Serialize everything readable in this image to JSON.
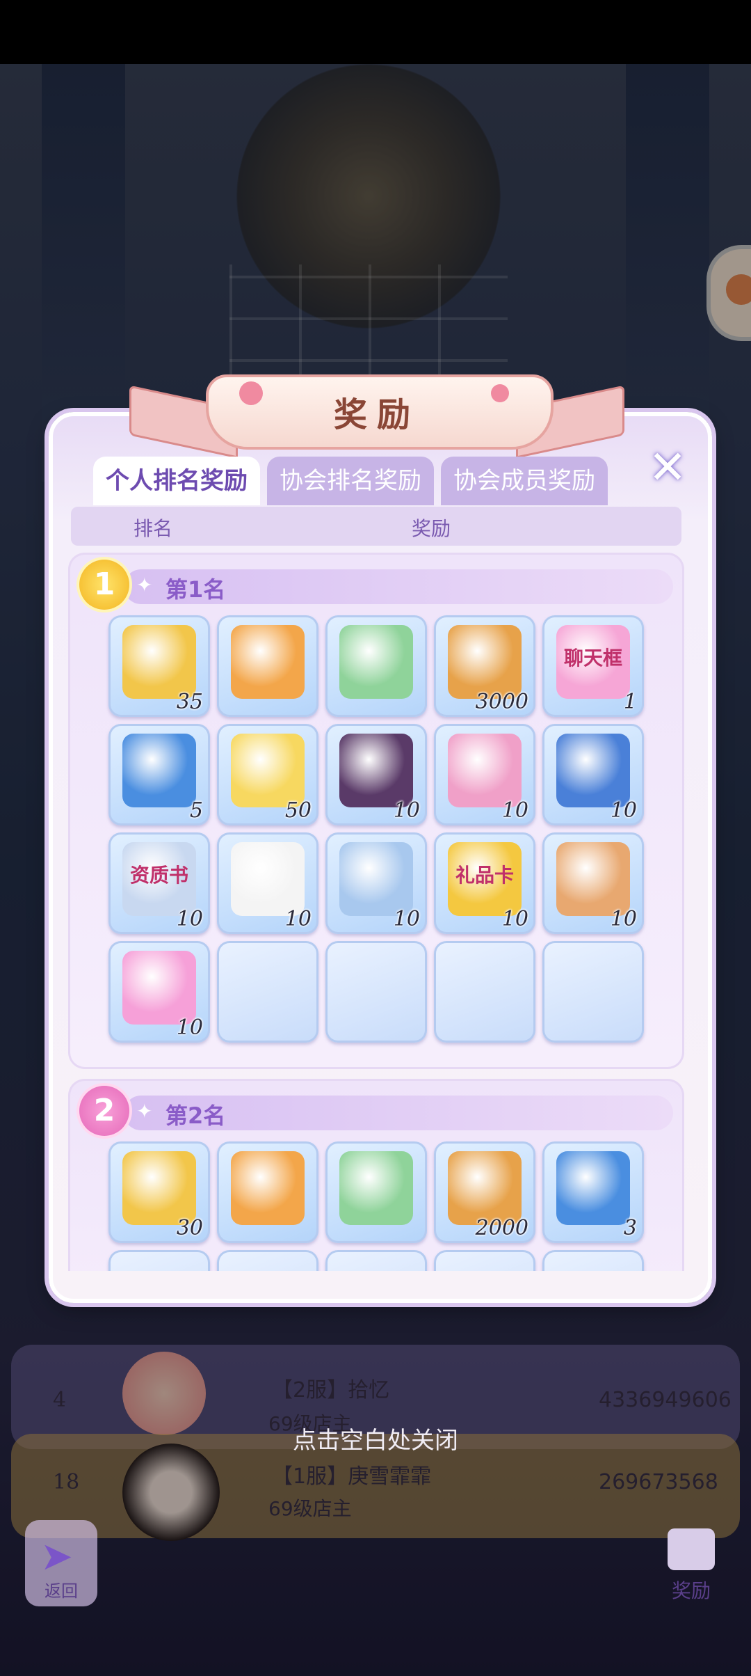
{
  "panel": {
    "title": "奖励",
    "tabs": [
      {
        "label": "个人排名奖励",
        "active": true
      },
      {
        "label": "协会排名奖励",
        "active": false
      },
      {
        "label": "协会成员奖励",
        "active": false
      }
    ],
    "columns": {
      "rank": "排名",
      "reward": "奖励"
    },
    "ranks": [
      {
        "badge": "1",
        "label": "第1名",
        "items": [
          {
            "icon": "scissors-icon",
            "qty": "35",
            "color": "#f2c64a"
          },
          {
            "icon": "lion-icon",
            "qty": "",
            "color": "#f3a64a"
          },
          {
            "icon": "bunny-icon",
            "qty": "",
            "color": "#8fd39a"
          },
          {
            "icon": "biscuit-icon",
            "qty": "3000",
            "color": "#e7a24a"
          },
          {
            "icon": "chat-frame-icon",
            "qty": "1",
            "text": "聊天框",
            "color": "#f6a6d6"
          },
          {
            "icon": "report-book-icon",
            "qty": "5",
            "color": "#4a8ee0"
          },
          {
            "icon": "rainbow-notebook-icon",
            "qty": "50",
            "color": "#f7d860"
          },
          {
            "icon": "suit-icon",
            "qty": "10",
            "color": "#5a3a68"
          },
          {
            "icon": "id-badge-icon",
            "qty": "10",
            "color": "#f0a0c8"
          },
          {
            "icon": "blue-book-icon",
            "qty": "10",
            "color": "#4a80d8"
          },
          {
            "icon": "certificate-icon",
            "qty": "10",
            "text": "资质书",
            "color": "#c8d8f0"
          },
          {
            "icon": "check-icon",
            "qty": "10",
            "color": "#f4f4f4"
          },
          {
            "icon": "cream-tube-icon",
            "qty": "10",
            "color": "#a8c8ee"
          },
          {
            "icon": "gift-card-icon",
            "qty": "10",
            "text": "礼品卡",
            "color": "#f4c840"
          },
          {
            "icon": "lipstick-icon",
            "qty": "10",
            "color": "#e8a870"
          },
          {
            "icon": "bow-icon",
            "qty": "10",
            "color": "#f6a0d8"
          }
        ],
        "empty_slots": 4
      },
      {
        "badge": "2",
        "label": "第2名",
        "items": [
          {
            "icon": "scissors-icon",
            "qty": "30",
            "color": "#f2c64a"
          },
          {
            "icon": "lion-icon",
            "qty": "",
            "color": "#f3a64a"
          },
          {
            "icon": "bunny-icon",
            "qty": "",
            "color": "#8fd39a"
          },
          {
            "icon": "biscuit-icon",
            "qty": "2000",
            "color": "#e7a24a"
          },
          {
            "icon": "report-book-icon",
            "qty": "3",
            "color": "#4a8ee0"
          }
        ]
      }
    ]
  },
  "close_hint": "点击空白处关闭",
  "leaderboard": [
    {
      "rank": "4",
      "name": "【2服】拾忆",
      "sub": "69级店主",
      "score": "4336949606"
    },
    {
      "rank": "18",
      "name": "【1服】庚雪霏霏",
      "sub": "69级店主",
      "score": "269673568"
    }
  ],
  "bottom": {
    "back_label": "返回",
    "reward_label": "奖励"
  }
}
